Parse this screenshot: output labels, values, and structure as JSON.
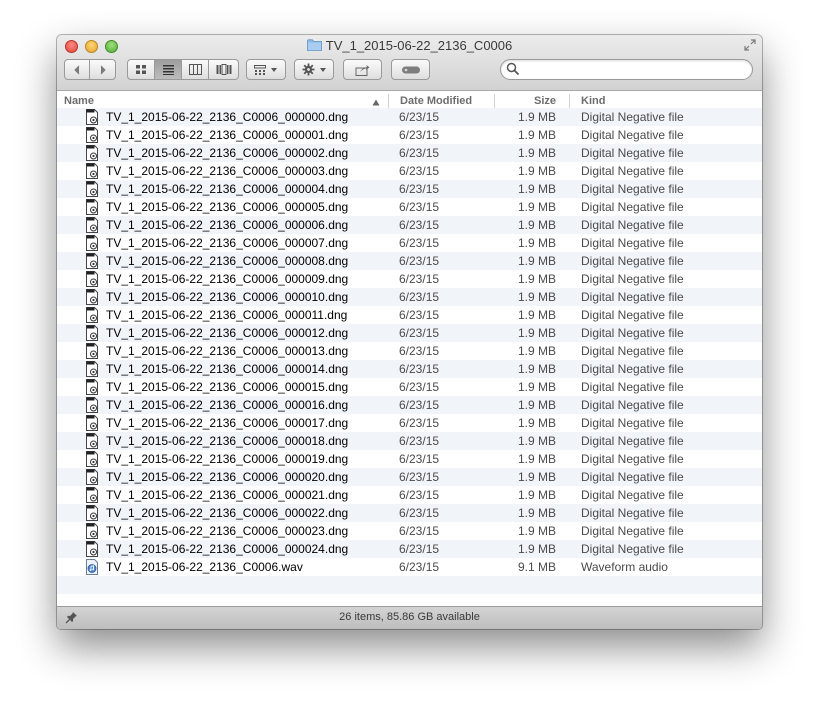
{
  "window": {
    "title": "TV_1_2015-06-22_2136_C0006"
  },
  "toolbar": {
    "back_icon": "chevron-left-icon",
    "forward_icon": "chevron-right-icon",
    "view_icons": [
      "icon-view-icon",
      "list-view-icon",
      "column-view-icon",
      "cover-flow-icon"
    ],
    "active_view": "list-view",
    "arrange_icon": "arrange-grid-icon",
    "action_icon": "gear-icon",
    "share_icon": "share-icon",
    "tag_icon": "tag-icon",
    "search": {
      "placeholder": "",
      "value": ""
    }
  },
  "columns": {
    "name": "Name",
    "date": "Date Modified",
    "size": "Size",
    "kind": "Kind",
    "sorted_by": "name",
    "sort_direction": "ascending"
  },
  "files": [
    {
      "name": "TV_1_2015-06-22_2136_C0006_000000.dng",
      "date": "6/23/15",
      "size": "1.9 MB",
      "kind": "Digital Negative file",
      "icon": "dng-file-icon"
    },
    {
      "name": "TV_1_2015-06-22_2136_C0006_000001.dng",
      "date": "6/23/15",
      "size": "1.9 MB",
      "kind": "Digital Negative file",
      "icon": "dng-file-icon"
    },
    {
      "name": "TV_1_2015-06-22_2136_C0006_000002.dng",
      "date": "6/23/15",
      "size": "1.9 MB",
      "kind": "Digital Negative file",
      "icon": "dng-file-icon"
    },
    {
      "name": "TV_1_2015-06-22_2136_C0006_000003.dng",
      "date": "6/23/15",
      "size": "1.9 MB",
      "kind": "Digital Negative file",
      "icon": "dng-file-icon"
    },
    {
      "name": "TV_1_2015-06-22_2136_C0006_000004.dng",
      "date": "6/23/15",
      "size": "1.9 MB",
      "kind": "Digital Negative file",
      "icon": "dng-file-icon"
    },
    {
      "name": "TV_1_2015-06-22_2136_C0006_000005.dng",
      "date": "6/23/15",
      "size": "1.9 MB",
      "kind": "Digital Negative file",
      "icon": "dng-file-icon"
    },
    {
      "name": "TV_1_2015-06-22_2136_C0006_000006.dng",
      "date": "6/23/15",
      "size": "1.9 MB",
      "kind": "Digital Negative file",
      "icon": "dng-file-icon"
    },
    {
      "name": "TV_1_2015-06-22_2136_C0006_000007.dng",
      "date": "6/23/15",
      "size": "1.9 MB",
      "kind": "Digital Negative file",
      "icon": "dng-file-icon"
    },
    {
      "name": "TV_1_2015-06-22_2136_C0006_000008.dng",
      "date": "6/23/15",
      "size": "1.9 MB",
      "kind": "Digital Negative file",
      "icon": "dng-file-icon"
    },
    {
      "name": "TV_1_2015-06-22_2136_C0006_000009.dng",
      "date": "6/23/15",
      "size": "1.9 MB",
      "kind": "Digital Negative file",
      "icon": "dng-file-icon"
    },
    {
      "name": "TV_1_2015-06-22_2136_C0006_000010.dng",
      "date": "6/23/15",
      "size": "1.9 MB",
      "kind": "Digital Negative file",
      "icon": "dng-file-icon"
    },
    {
      "name": "TV_1_2015-06-22_2136_C0006_000011.dng",
      "date": "6/23/15",
      "size": "1.9 MB",
      "kind": "Digital Negative file",
      "icon": "dng-file-icon"
    },
    {
      "name": "TV_1_2015-06-22_2136_C0006_000012.dng",
      "date": "6/23/15",
      "size": "1.9 MB",
      "kind": "Digital Negative file",
      "icon": "dng-file-icon"
    },
    {
      "name": "TV_1_2015-06-22_2136_C0006_000013.dng",
      "date": "6/23/15",
      "size": "1.9 MB",
      "kind": "Digital Negative file",
      "icon": "dng-file-icon"
    },
    {
      "name": "TV_1_2015-06-22_2136_C0006_000014.dng",
      "date": "6/23/15",
      "size": "1.9 MB",
      "kind": "Digital Negative file",
      "icon": "dng-file-icon"
    },
    {
      "name": "TV_1_2015-06-22_2136_C0006_000015.dng",
      "date": "6/23/15",
      "size": "1.9 MB",
      "kind": "Digital Negative file",
      "icon": "dng-file-icon"
    },
    {
      "name": "TV_1_2015-06-22_2136_C0006_000016.dng",
      "date": "6/23/15",
      "size": "1.9 MB",
      "kind": "Digital Negative file",
      "icon": "dng-file-icon"
    },
    {
      "name": "TV_1_2015-06-22_2136_C0006_000017.dng",
      "date": "6/23/15",
      "size": "1.9 MB",
      "kind": "Digital Negative file",
      "icon": "dng-file-icon"
    },
    {
      "name": "TV_1_2015-06-22_2136_C0006_000018.dng",
      "date": "6/23/15",
      "size": "1.9 MB",
      "kind": "Digital Negative file",
      "icon": "dng-file-icon"
    },
    {
      "name": "TV_1_2015-06-22_2136_C0006_000019.dng",
      "date": "6/23/15",
      "size": "1.9 MB",
      "kind": "Digital Negative file",
      "icon": "dng-file-icon"
    },
    {
      "name": "TV_1_2015-06-22_2136_C0006_000020.dng",
      "date": "6/23/15",
      "size": "1.9 MB",
      "kind": "Digital Negative file",
      "icon": "dng-file-icon"
    },
    {
      "name": "TV_1_2015-06-22_2136_C0006_000021.dng",
      "date": "6/23/15",
      "size": "1.9 MB",
      "kind": "Digital Negative file",
      "icon": "dng-file-icon"
    },
    {
      "name": "TV_1_2015-06-22_2136_C0006_000022.dng",
      "date": "6/23/15",
      "size": "1.9 MB",
      "kind": "Digital Negative file",
      "icon": "dng-file-icon"
    },
    {
      "name": "TV_1_2015-06-22_2136_C0006_000023.dng",
      "date": "6/23/15",
      "size": "1.9 MB",
      "kind": "Digital Negative file",
      "icon": "dng-file-icon"
    },
    {
      "name": "TV_1_2015-06-22_2136_C0006_000024.dng",
      "date": "6/23/15",
      "size": "1.9 MB",
      "kind": "Digital Negative file",
      "icon": "dng-file-icon"
    },
    {
      "name": "TV_1_2015-06-22_2136_C0006.wav",
      "date": "6/23/15",
      "size": "9.1 MB",
      "kind": "Waveform audio",
      "icon": "audio-file-icon"
    }
  ],
  "status": {
    "text": "26 items, 85.86 GB available",
    "icon": "pin-icon"
  },
  "colors": {
    "row_alt": "#f1f5fa",
    "close": "#e0443a",
    "minimize": "#e3a32a",
    "zoom": "#53ad3a"
  }
}
